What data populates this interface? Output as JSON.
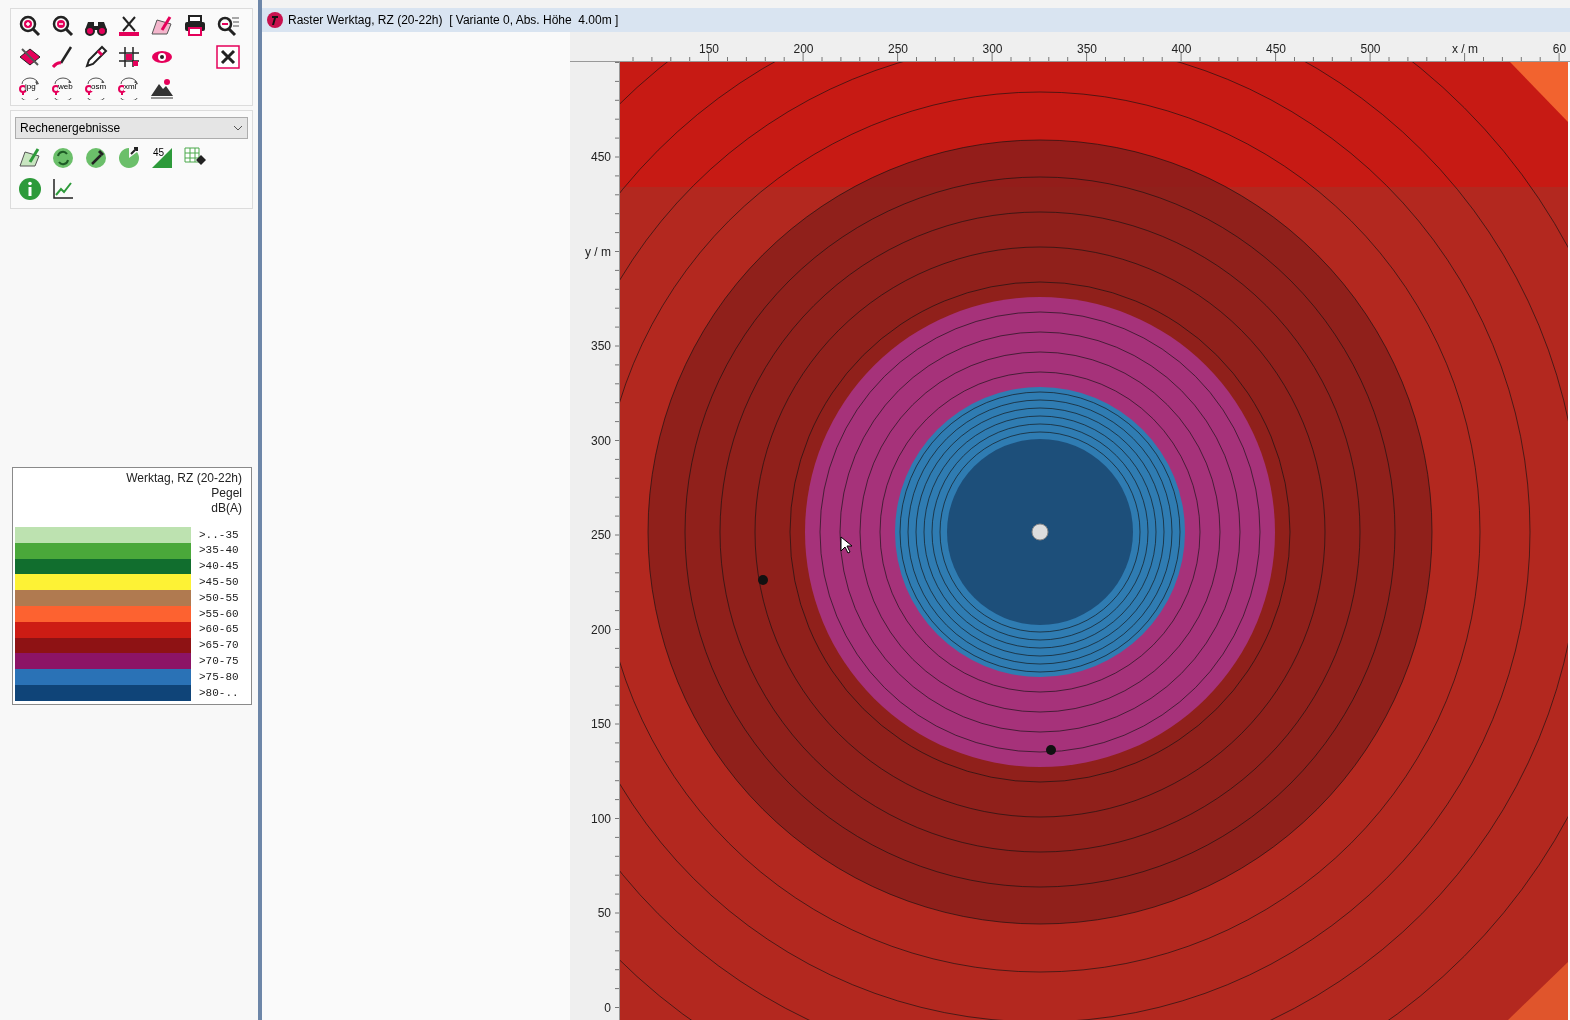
{
  "toolbar": {
    "rows": [
      [
        {
          "kind": "zoom-in"
        },
        {
          "kind": "zoom-out"
        },
        {
          "kind": "binoculars"
        },
        {
          "kind": "measure"
        },
        {
          "kind": "edit-area"
        },
        {
          "kind": "print"
        },
        {
          "kind": "zoom-list"
        }
      ],
      [
        {
          "kind": "layers"
        },
        {
          "kind": "brush"
        },
        {
          "kind": "pencil"
        },
        {
          "kind": "grid"
        },
        {
          "kind": "eye"
        },
        {
          "kind": "tools"
        }
      ],
      [
        {
          "kind": "export",
          "label": "jpg"
        },
        {
          "kind": "export",
          "label": "web"
        },
        {
          "kind": "export",
          "label": "osm"
        },
        {
          "kind": "export",
          "label": "xml"
        },
        {
          "kind": "landscape"
        }
      ]
    ]
  },
  "results_panel": {
    "dropdown": "Rechenergebnisse",
    "rows": [
      [
        {
          "kind": "edit-result"
        },
        {
          "kind": "refresh"
        },
        {
          "kind": "pipette"
        },
        {
          "kind": "rotate"
        },
        {
          "kind": "slope",
          "label": "45"
        },
        {
          "kind": "table-eraser"
        }
      ],
      [
        {
          "kind": "info"
        },
        {
          "kind": "chart"
        }
      ]
    ]
  },
  "legend": {
    "title": "Werktag, RZ (20-22h)",
    "quantity": "Pegel",
    "unit": "dB(A)",
    "items": [
      {
        "label": ">..-35",
        "color": "#bde2b0"
      },
      {
        "label": ">35-40",
        "color": "#4aa83a"
      },
      {
        "label": ">40-45",
        "color": "#116e2e"
      },
      {
        "label": ">45-50",
        "color": "#fdf235"
      },
      {
        "label": ">50-55",
        "color": "#b07a50"
      },
      {
        "label": ">55-60",
        "color": "#fd6230"
      },
      {
        "label": ">60-65",
        "color": "#cd1c14"
      },
      {
        "label": ">65-70",
        "color": "#8e1214"
      },
      {
        "label": ">70-75",
        "color": "#8c1466"
      },
      {
        "label": ">75-80",
        "color": "#2a72b6"
      },
      {
        "label": ">80-..",
        "color": "#0f4478"
      }
    ]
  },
  "window": {
    "title": "Raster Werktag, RZ (20-22h)  [ Variante 0, Abs. Höhe  4.00m ]"
  },
  "map": {
    "x_ruler": [
      "150",
      "200",
      "250",
      "300",
      "350",
      "400",
      "450",
      "500",
      "x / m",
      "60"
    ],
    "y_ruler": [
      "450",
      "y / m",
      "350",
      "300",
      "250",
      "200",
      "150",
      "100",
      "50",
      "0"
    ]
  }
}
